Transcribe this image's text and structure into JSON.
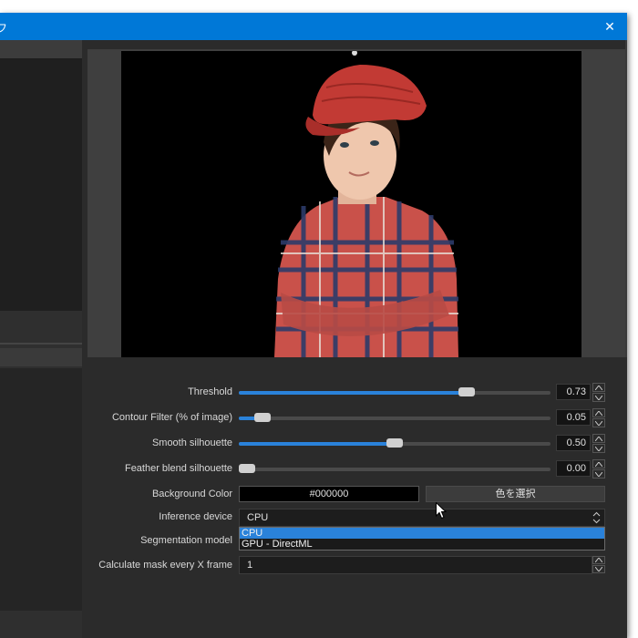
{
  "window": {
    "title": "フ",
    "close_glyph": "✕"
  },
  "properties": {
    "threshold": {
      "label": "Threshold",
      "value": "0.73",
      "fraction": 0.73
    },
    "contour_filter": {
      "label": "Contour Filter (% of image)",
      "value": "0.05",
      "fraction": 0.075
    },
    "smooth_silhouette": {
      "label": "Smooth silhouette",
      "value": "0.50",
      "fraction": 0.5
    },
    "feather_blend": {
      "label": "Feather blend silhouette",
      "value": "0.00",
      "fraction": 0.0
    },
    "background_color": {
      "label": "Background Color",
      "value": "#000000",
      "button": "色を選択"
    },
    "inference_device": {
      "label": "Inference device",
      "value": "CPU",
      "options": [
        "CPU",
        "GPU - DirectML"
      ]
    },
    "segmentation_model": {
      "label": "Segmentation model"
    },
    "calc_mask": {
      "label": "Calculate mask every X frame",
      "value": "1"
    }
  },
  "colors": {
    "accent": "#2a82da",
    "titlebar": "#0078d7",
    "panel": "#2b2b2b"
  }
}
